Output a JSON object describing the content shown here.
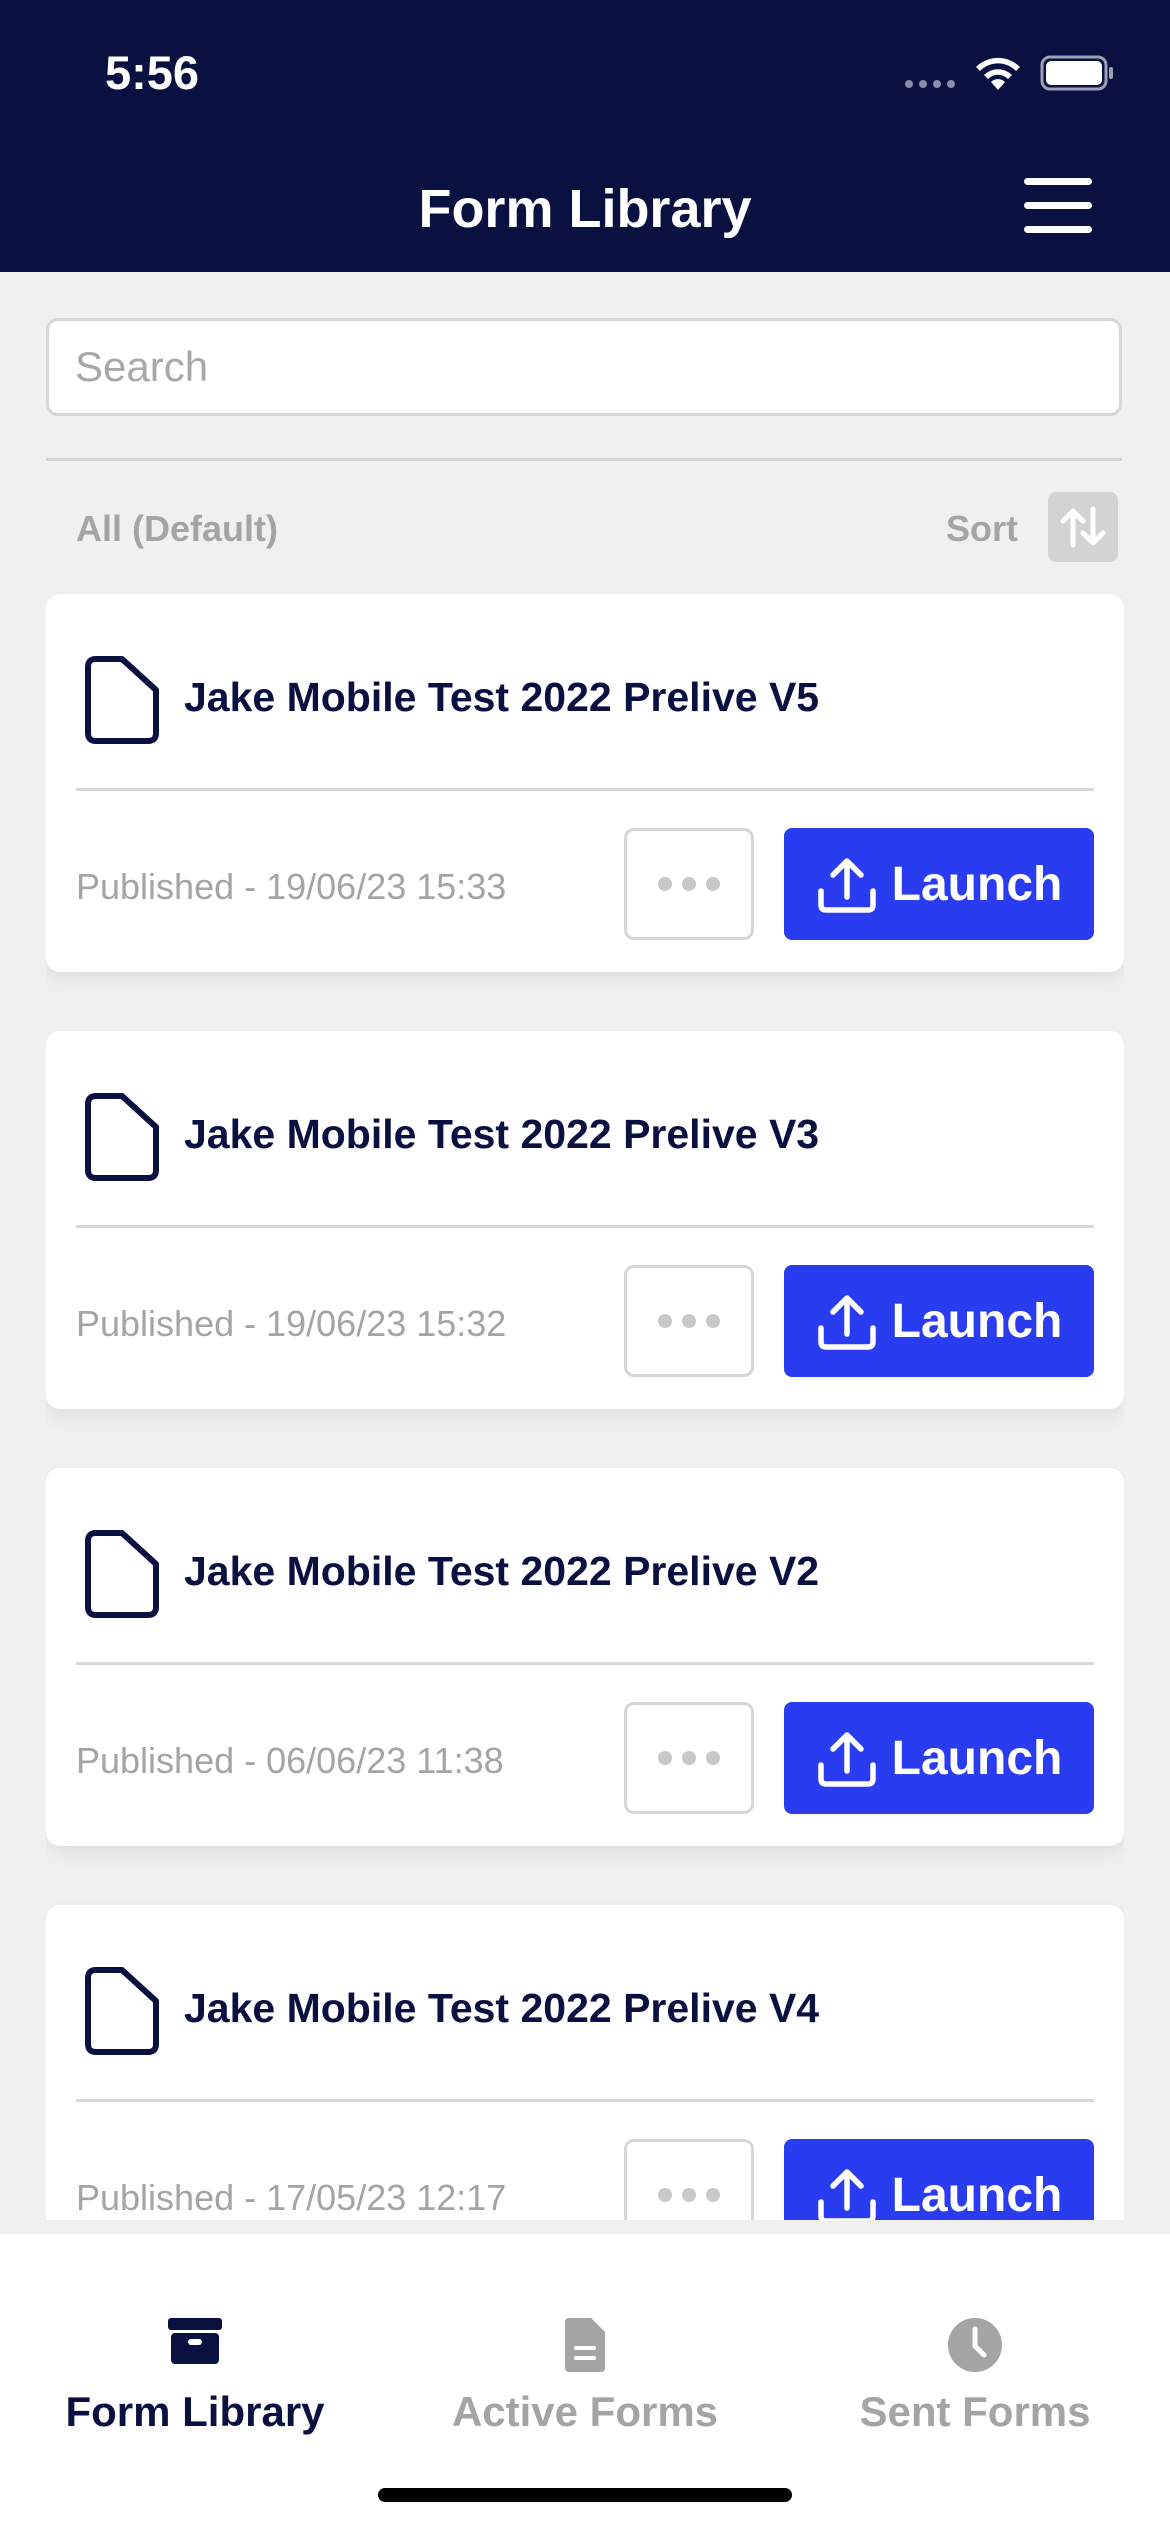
{
  "status_bar": {
    "time": "5:56"
  },
  "header": {
    "title": "Form Library"
  },
  "search": {
    "placeholder": "Search"
  },
  "filter": {
    "label": "All (Default)",
    "sort_label": "Sort"
  },
  "forms": [
    {
      "title": "Jake Mobile Test 2022 Prelive V5",
      "published": "Published - 19/06/23 15:33",
      "launch_label": "Launch"
    },
    {
      "title": "Jake Mobile Test 2022 Prelive V3",
      "published": "Published - 19/06/23 15:32",
      "launch_label": "Launch"
    },
    {
      "title": "Jake Mobile Test 2022 Prelive V2",
      "published": "Published - 06/06/23 11:38",
      "launch_label": "Launch"
    },
    {
      "title": "Jake Mobile Test 2022 Prelive V4",
      "published": "Published - 17/05/23 12:17",
      "launch_label": "Launch"
    }
  ],
  "tabs": [
    {
      "label": "Form Library",
      "icon": "archive-box-icon",
      "active": true
    },
    {
      "label": "Active Forms",
      "icon": "document-icon",
      "active": false
    },
    {
      "label": "Sent Forms",
      "icon": "clock-icon",
      "active": false
    }
  ],
  "colors": {
    "header_bg": "#0a1140",
    "accent": "#2a3cf0",
    "inactive": "#a4a4a4"
  }
}
